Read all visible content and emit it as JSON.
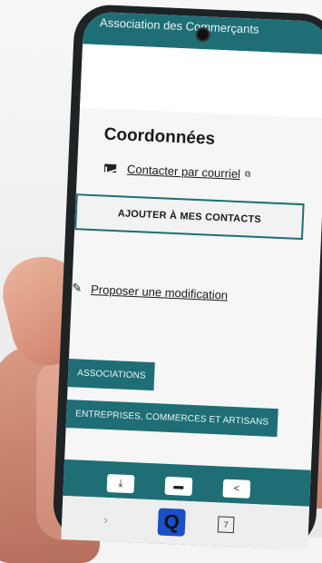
{
  "app": {
    "title": "Association des Commerçants"
  },
  "contact": {
    "section_title": "Coordonnées",
    "email_link": "Contacter par courriel",
    "add_contacts_button": "AJOUTER À MES CONTACTS",
    "propose_link": "Proposer une modification"
  },
  "tags": [
    "ASSOCIATIONS",
    "ENTREPRISES, COMMERCES ET ARTISANS"
  ],
  "bottom_buttons": [
    {
      "icon": "download-icon",
      "glyph": "⤓"
    },
    {
      "icon": "car-icon",
      "glyph": "▬"
    },
    {
      "icon": "share-icon",
      "glyph": "<"
    }
  ],
  "nav": {
    "q_label": "Q",
    "tab_count": "7",
    "chevron": "›"
  },
  "colors": {
    "accent": "#1f6e76",
    "q_brand": "#1a4fc6"
  },
  "icons": {
    "email": "mail-icon",
    "external": "external-link-icon",
    "edit": "pencil-icon"
  }
}
